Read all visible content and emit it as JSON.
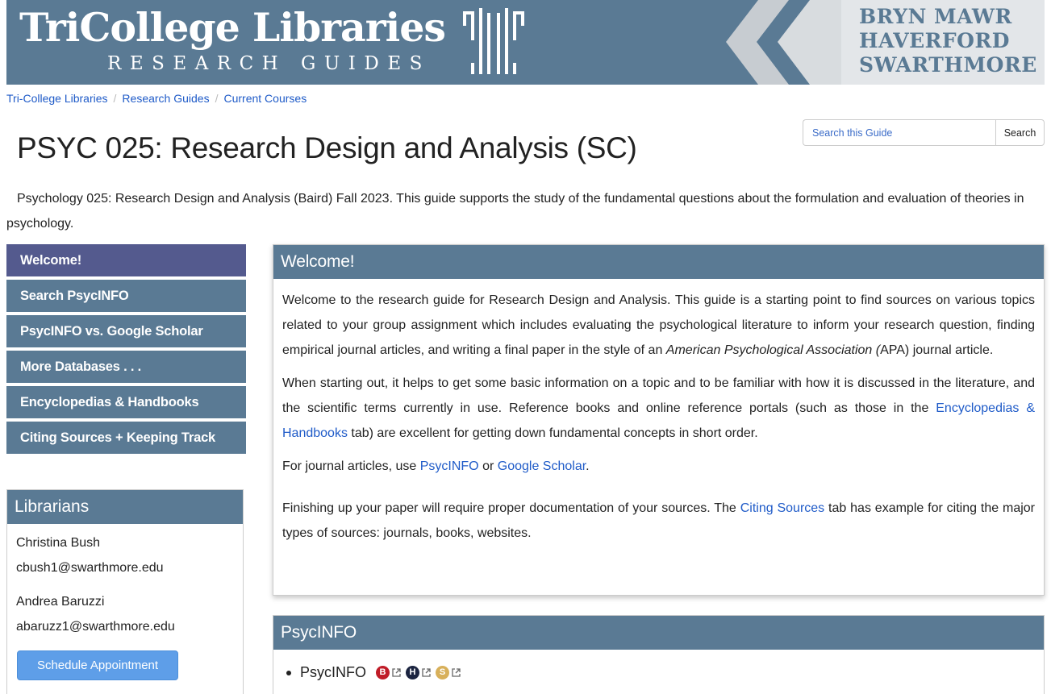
{
  "banner": {
    "title": "TriCollege Libraries",
    "subtitle": "RESEARCH GUIDES",
    "colleges": [
      "BRYN MAWR",
      "HAVERFORD",
      "SWARTHMORE"
    ]
  },
  "breadcrumb": [
    "Tri-College Libraries",
    "Research Guides",
    "Current Courses"
  ],
  "search": {
    "placeholder": "Search this Guide",
    "button": "Search"
  },
  "page": {
    "title": "PSYC 025: Research Design and Analysis (SC)",
    "description": "Psychology 025: Research Design and Analysis (Baird) Fall 2023. This guide supports the study of the fundamental questions about the formulation and evaluation of theories in psychology."
  },
  "nav": [
    "Welcome!",
    "Search PsycINFO",
    "PsycINFO vs. Google Scholar",
    "More Databases . . .",
    "Encyclopedias & Handbooks",
    "Citing Sources + Keeping Track"
  ],
  "librarians": {
    "heading": "Librarians",
    "people": [
      {
        "name": "Christina Bush",
        "email": "cbush1@swarthmore.edu"
      },
      {
        "name": "Andrea Baruzzi",
        "email": "abaruzz1@swarthmore.edu"
      }
    ],
    "button": "Schedule Appointment"
  },
  "welcome": {
    "heading": "Welcome!",
    "p1_a": "Welcome to the research guide for Research Design and Analysis. This guide is a starting point to find sources on various topics related to your group assignment which includes evaluating the psychological literature to inform your research question, finding empirical journal articles, and writing a final paper in the style of an ",
    "p1_em": "American Psychological Association (",
    "p1_b": "APA) journal article.",
    "p2_a": "When starting out, it helps to get some basic information on a topic and to be familiar with how it is discussed in the literature, and the scientific terms currently in use. Reference books and online reference portals (such as those in the ",
    "p2_link": "Encyclopedias & Handbooks",
    "p2_b": " tab) are excellent for getting down fundamental concepts in short order.",
    "p3_a": "For journal articles, use ",
    "p3_link1": "PsycINFO",
    "p3_mid": " or ",
    "p3_link2": "Google Scholar",
    "p3_b": ".",
    "p4_a": "Finishing up your paper will require proper documentation of your sources. The ",
    "p4_link": "Citing Sources",
    "p4_b": " tab has example for citing the major types of sources: journals, books, websites."
  },
  "psycinfo": {
    "heading": "PsycINFO",
    "item": "PsycINFO",
    "badges": [
      {
        "letter": "B",
        "color": "#c01c28"
      },
      {
        "letter": "H",
        "color": "#1b2440"
      },
      {
        "letter": "S",
        "color": "#d8b05a"
      }
    ]
  }
}
